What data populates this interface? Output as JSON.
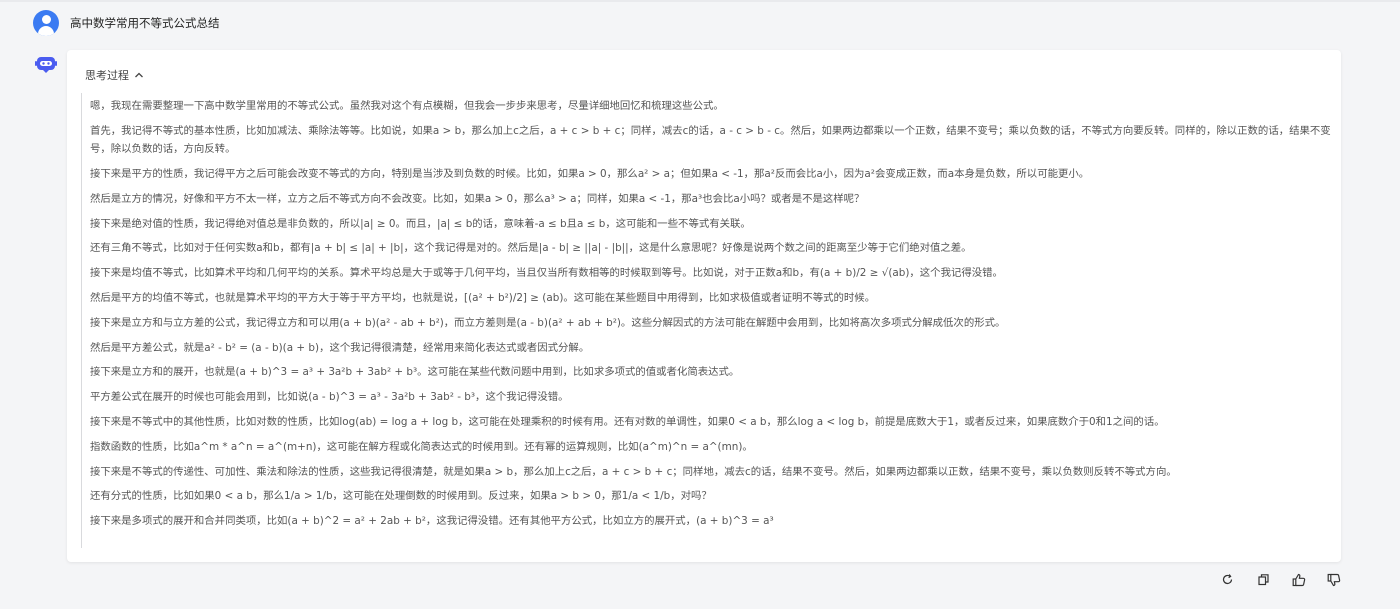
{
  "conversation": {
    "user_question": "高中数学常用不等式公式总结",
    "thinking_label": "思考过程",
    "paragraphs": [
      "嗯，我现在需要整理一下高中数学里常用的不等式公式。虽然我对这个有点模糊，但我会一步步来思考，尽量详细地回忆和梳理这些公式。",
      "首先，我记得不等式的基本性质，比如加减法、乘除法等等。比如说，如果a > b，那么加上c之后，a + c > b + c；同样，减去c的话，a - c > b - c。然后，如果两边都乘以一个正数，结果不变号；乘以负数的话，不等式方向要反转。同样的，除以正数的话，结果不变号，除以负数的话，方向反转。",
      "接下来是平方的性质，我记得平方之后可能会改变不等式的方向，特别是当涉及到负数的时候。比如，如果a > 0，那么a² > a；但如果a < -1，那a²反而会比a小，因为a²会变成正数，而a本身是负数，所以可能更小。",
      "然后是立方的情况，好像和平方不太一样，立方之后不等式方向不会改变。比如，如果a > 0，那么a³ > a；同样，如果a < -1，那a³也会比a小吗？或者是不是这样呢？",
      "接下来是绝对值的性质，我记得绝对值总是非负数的，所以|a| ≥ 0。而且，|a| ≤ b的话，意味着-a ≤ b且a ≤ b，这可能和一些不等式有关联。",
      "还有三角不等式，比如对于任何实数a和b，都有|a + b| ≤ |a| + |b|，这个我记得是对的。然后是|a - b| ≥ ||a| - |b||，这是什么意思呢？好像是说两个数之间的距离至少等于它们绝对值之差。",
      "接下来是均值不等式，比如算术平均和几何平均的关系。算术平均总是大于或等于几何平均，当且仅当所有数相等的时候取到等号。比如说，对于正数a和b，有(a + b)/2 ≥ √(ab)，这个我记得没错。",
      "然后是平方的均值不等式，也就是算术平均的平方大于等于平方平均，也就是说，[(a² + b²)/2] ≥ (ab)。这可能在某些题目中用得到，比如求极值或者证明不等式的时候。",
      "接下来是立方和与立方差的公式，我记得立方和可以用(a + b)(a² - ab + b²)，而立方差则是(a - b)(a² + ab + b²)。这些分解因式的方法可能在解题中会用到，比如将高次多项式分解成低次的形式。",
      "然后是平方差公式，就是a² - b² = (a - b)(a + b)，这个我记得很清楚，经常用来简化表达式或者因式分解。",
      "接下来是立方和的展开，也就是(a + b)^3 = a³ + 3a²b + 3ab² + b³。这可能在某些代数问题中用到，比如求多项式的值或者化简表达式。",
      "平方差公式在展开的时候也可能会用到，比如说(a - b)^3 = a³ - 3a²b + 3ab² - b³，这个我记得没错。",
      "接下来是不等式中的其他性质，比如对数的性质，比如log(ab) = log a + log b，这可能在处理乘积的时候有用。还有对数的单调性，如果0 < a b，那么log a < log b，前提是底数大于1，或者反过来，如果底数介于0和1之间的话。",
      "指数函数的性质，比如a^m * a^n = a^(m+n)，这可能在解方程或化简表达式的时候用到。还有幂的运算规则，比如(a^m)^n = a^(mn)。",
      "接下来是不等式的传递性、可加性、乘法和除法的性质，这些我记得很清楚，就是如果a > b，那么加上c之后，a + c > b + c；同样地，减去c的话，结果不变号。然后，如果两边都乘以正数，结果不变号，乘以负数则反转不等式方向。",
      "还有分式的性质，比如如果0 < a b，那么1/a > 1/b，这可能在处理倒数的时候用到。反过来，如果a > b > 0，那1/a < 1/b，对吗？",
      "接下来是多项式的展开和合并同类项，比如(a + b)^2 = a² + 2ab + b²，这我记得没错。还有其他平方公式，比如立方的展开式，(a + b)^3 = a³"
    ]
  },
  "actions": {
    "icons": [
      "refresh-icon",
      "copy-icon",
      "thumbs-up-icon",
      "thumbs-down-icon"
    ]
  },
  "colors": {
    "background": "#f4f5f7",
    "card": "#ffffff",
    "user_avatar": "#3b7bf2",
    "bot_avatar": "#4a5cf0",
    "text_muted": "#555555"
  }
}
